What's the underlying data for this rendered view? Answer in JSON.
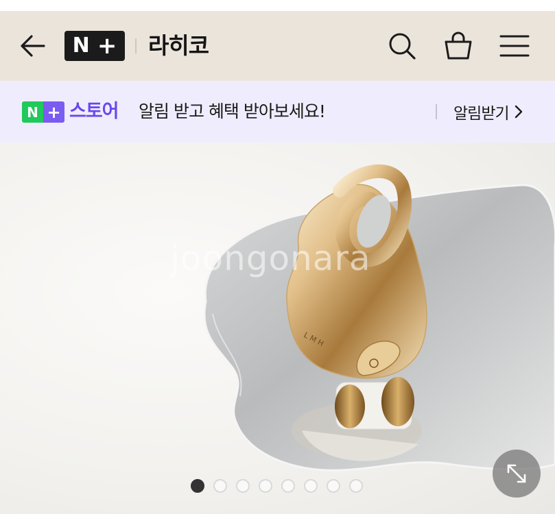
{
  "header": {
    "logo_n": "N",
    "logo_plus": "+",
    "brand_name": "라히코",
    "icons": {
      "back": "arrow-left-icon",
      "search": "search-icon",
      "cart": "shopping-bag-icon",
      "menu": "hamburger-menu-icon"
    },
    "background": "#ebe4db"
  },
  "banner": {
    "logo_n": "N",
    "logo_plus": "+",
    "store_label": "스토어",
    "message": "알림 받고 혜택 받아보세요!",
    "action_label": "알림받기",
    "background": "#efedfd",
    "store_color": "#6a48ec",
    "logo_green": "#1fc95a",
    "logo_purple": "#7b5cf0"
  },
  "gallery": {
    "watermark": "joongonara",
    "product_engraving": "L M H",
    "total_images": 8,
    "current_index": 1,
    "expand_icon": "expand-icon"
  }
}
